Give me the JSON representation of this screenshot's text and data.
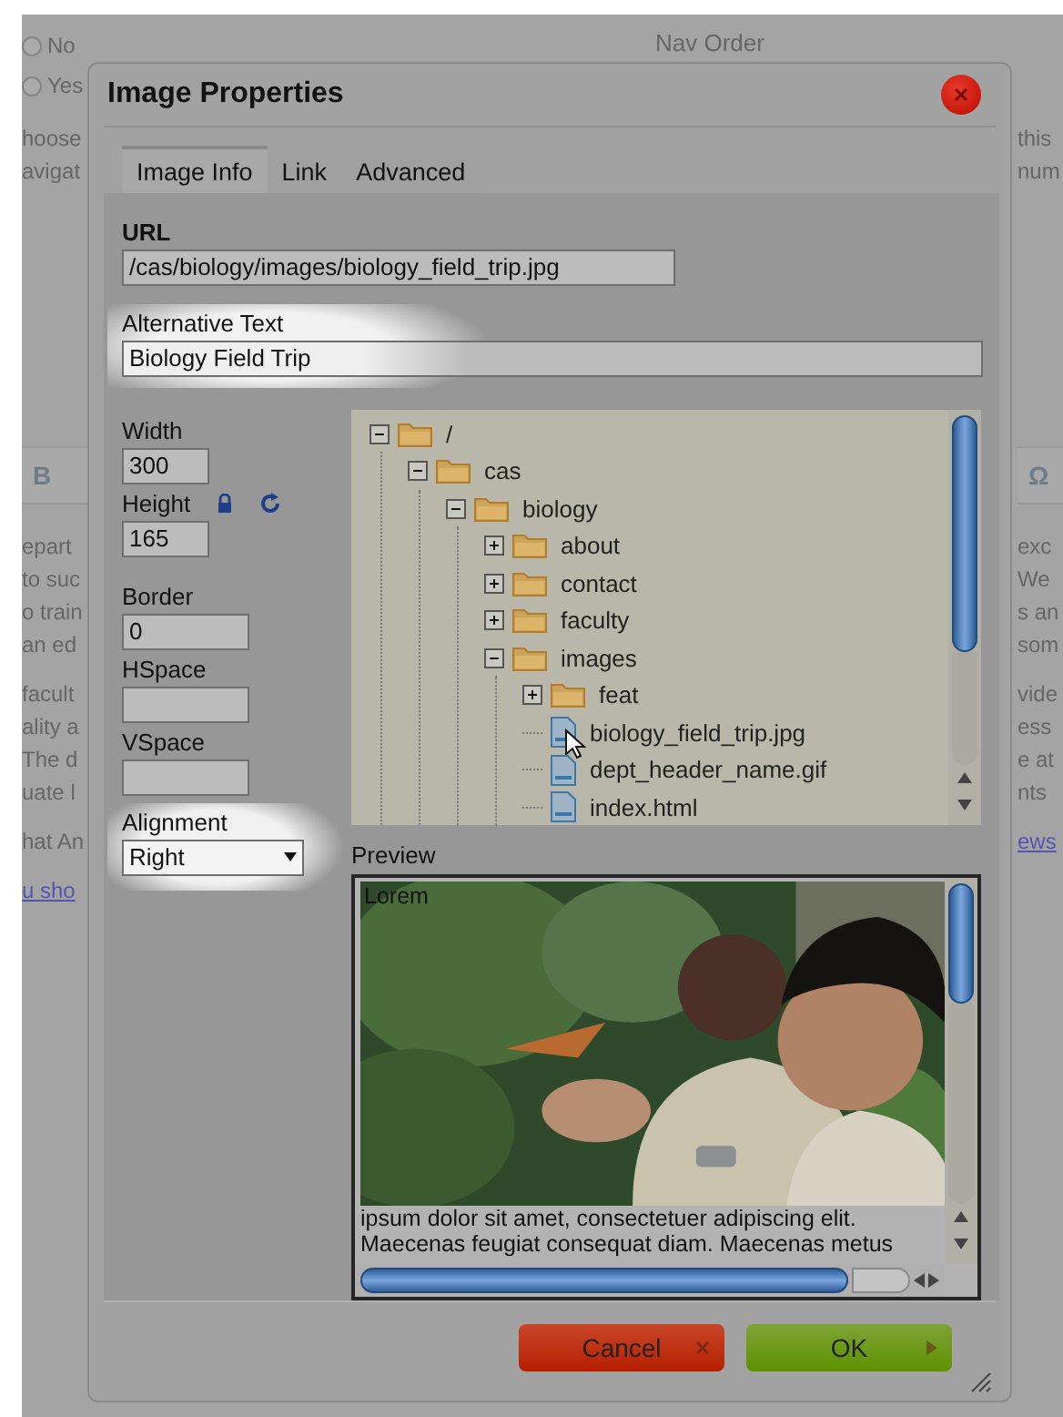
{
  "background_page": {
    "nav_order_label": "Nav Order",
    "left": {
      "radios": [
        {
          "label": "No",
          "selected": false
        },
        {
          "label": "Yes",
          "selected": false
        }
      ],
      "hint": [
        "hoose",
        "avigat"
      ],
      "toolbar": [
        "B"
      ],
      "paragraphs": [
        [
          "epart",
          "to suc",
          "o train",
          "an ed"
        ],
        [
          "facult",
          "ality a",
          "The d",
          "uate l"
        ],
        [
          "hat An"
        ]
      ],
      "link": "u sho"
    },
    "right": {
      "hint": [
        "this",
        "num"
      ],
      "toolbar": [
        "Ω"
      ],
      "paragraphs": [
        [
          "exc",
          "We",
          "s an",
          "som"
        ],
        [
          "vide",
          "ess",
          "e at",
          "nts"
        ]
      ],
      "link": "ews"
    }
  },
  "dialog": {
    "title": "Image Properties",
    "tabs": [
      {
        "label": "Image Info",
        "selected": true
      },
      {
        "label": "Link",
        "selected": false
      },
      {
        "label": "Advanced",
        "selected": false
      }
    ],
    "url": {
      "label": "URL",
      "value": "/cas/biology/images/biology_field_trip.jpg"
    },
    "alt_text": {
      "label": "Alternative Text",
      "value": "Biology Field Trip",
      "highlighted": true
    },
    "size_fields": [
      {
        "label": "Width",
        "value": "300",
        "kind": "small"
      },
      {
        "label": "Height",
        "value": "165",
        "kind": "small"
      }
    ],
    "spacing_fields": [
      {
        "label": "Border",
        "value": "0"
      },
      {
        "label": "HSpace"
      },
      {
        "label": "VSpace"
      }
    ],
    "alignment": {
      "label": "Alignment",
      "value": "Right",
      "highlighted": true
    },
    "tree": [
      {
        "label": "/",
        "kind": "folder",
        "expanded": true,
        "children": [
          {
            "label": "cas",
            "kind": "folder",
            "expanded": true,
            "children": [
              {
                "label": "biology",
                "kind": "folder",
                "expanded": true,
                "children": [
                  {
                    "label": "about",
                    "kind": "folder",
                    "expanded": false
                  },
                  {
                    "label": "contact",
                    "kind": "folder",
                    "expanded": false
                  },
                  {
                    "label": "faculty",
                    "kind": "folder",
                    "expanded": false
                  },
                  {
                    "label": "images",
                    "kind": "folder",
                    "expanded": true,
                    "children": [
                      {
                        "label": "feat",
                        "kind": "folder",
                        "expanded": false
                      },
                      {
                        "label": "biology_field_trip.jpg",
                        "kind": "file",
                        "pointer": true
                      },
                      {
                        "label": "dept_header_name.gif",
                        "kind": "file"
                      },
                      {
                        "label": "index.html",
                        "kind": "file"
                      }
                    ]
                  }
                ]
              }
            ]
          }
        ]
      }
    ],
    "preview": {
      "label": "Preview",
      "first_word": "Lorem",
      "text": "ipsum dolor sit amet, consectetuer adipiscing elit. Maecenas feugiat consequat diam. Maecenas metus"
    },
    "buttons": [
      {
        "label": "Cancel",
        "kind": "cancel"
      },
      {
        "label": "OK",
        "kind": "ok"
      }
    ]
  }
}
